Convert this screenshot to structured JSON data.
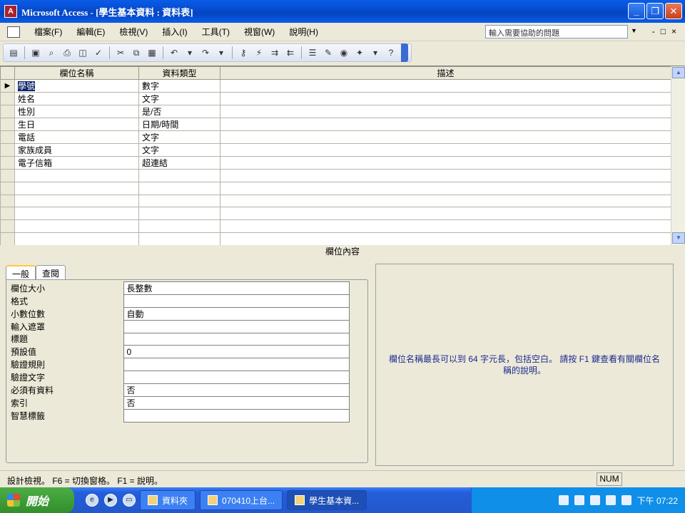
{
  "window": {
    "title": "Microsoft Access - [學生基本資料 : 資料表]",
    "minimize": "_",
    "restore": "❐",
    "close": "✕"
  },
  "menu": {
    "items": [
      "檔案(F)",
      "編輯(E)",
      "檢視(V)",
      "插入(I)",
      "工具(T)",
      "視窗(W)",
      "說明(H)"
    ],
    "ask_placeholder": "輸入需要協助的問題",
    "doc_controls": [
      "-",
      "□",
      "×"
    ]
  },
  "grid": {
    "headers": [
      "欄位名稱",
      "資料類型",
      "描述"
    ],
    "rows": [
      {
        "name": "學號",
        "type": "數字",
        "desc": ""
      },
      {
        "name": "姓名",
        "type": "文字",
        "desc": ""
      },
      {
        "name": "性別",
        "type": "是/否",
        "desc": ""
      },
      {
        "name": "生日",
        "type": "日期/時間",
        "desc": ""
      },
      {
        "name": "電話",
        "type": "文字",
        "desc": ""
      },
      {
        "name": "家族成員",
        "type": "文字",
        "desc": ""
      },
      {
        "name": "電子信箱",
        "type": "超連結",
        "desc": ""
      }
    ],
    "empty_rows": 6,
    "current_row_marker": "▶"
  },
  "properties": {
    "section_title": "欄位內容",
    "tabs": [
      "一般",
      "查閱"
    ],
    "items": [
      {
        "label": "欄位大小",
        "value": "長整數"
      },
      {
        "label": "格式",
        "value": ""
      },
      {
        "label": "小數位數",
        "value": "自動"
      },
      {
        "label": "輸入遮罩",
        "value": ""
      },
      {
        "label": "標題",
        "value": ""
      },
      {
        "label": "預設值",
        "value": "0"
      },
      {
        "label": "驗證規則",
        "value": ""
      },
      {
        "label": "驗證文字",
        "value": ""
      },
      {
        "label": "必須有資料",
        "value": "否"
      },
      {
        "label": "索引",
        "value": "否"
      },
      {
        "label": "智慧標籤",
        "value": ""
      }
    ],
    "help_text": "欄位名稱最長可以到 64 字元長，包括空白。 請按 F1 鍵查看有關欄位名稱的說明。"
  },
  "status": {
    "left": "設計檢視。 F6 = 切換窗格。 F1 = 說明。",
    "right": "NUM"
  },
  "taskbar": {
    "start": "開始",
    "buttons": [
      {
        "label": "資料夾",
        "active": false
      },
      {
        "label": "070410上台...",
        "active": false
      },
      {
        "label": "學生基本資...",
        "active": true
      }
    ],
    "clock": "下午 07:22"
  }
}
